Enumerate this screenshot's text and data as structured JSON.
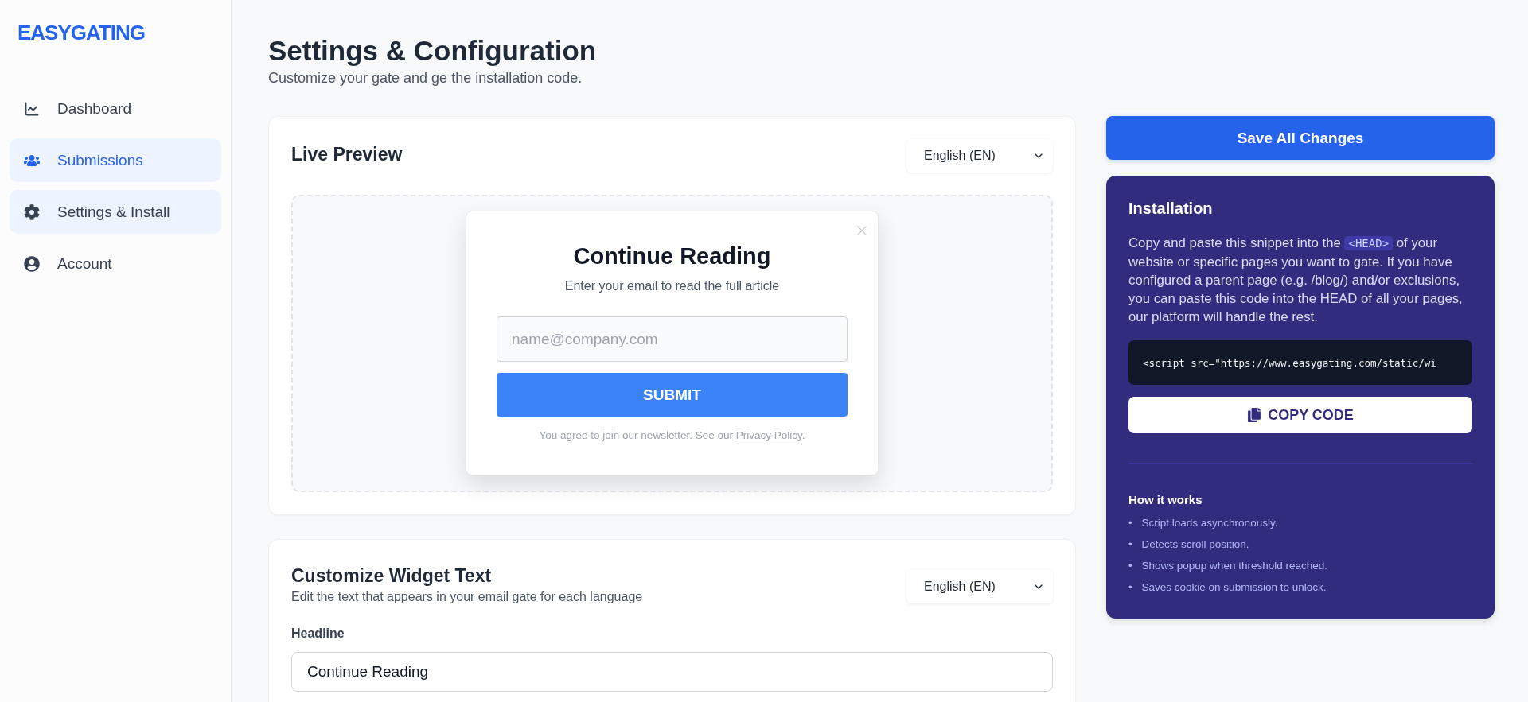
{
  "sidebar": {
    "logo": "EASYGATING",
    "items": [
      {
        "label": "Dashboard",
        "selected": false,
        "hovered": false
      },
      {
        "label": "Submissions",
        "selected": true,
        "hovered": false
      },
      {
        "label": "Settings & Install",
        "selected": false,
        "hovered": true
      },
      {
        "label": "Account",
        "selected": false,
        "hovered": false
      }
    ]
  },
  "header": {
    "title": "Settings & Configuration",
    "subtitle": "Customize your gate and ge the installation code."
  },
  "live_preview": {
    "title": "Live Preview",
    "language": "English (EN)",
    "popup": {
      "title": "Continue Reading",
      "subtitle": "Enter your email to read the full article",
      "placeholder": "name@company.com",
      "button": "SUBMIT",
      "footer": "You agree to join our newsletter. See our ",
      "footer_link": "Privacy Policy",
      "footer_end": "."
    }
  },
  "customize": {
    "title": "Customize Widget Text",
    "subtitle": "Edit the text that appears in your email gate for each language",
    "language": "English (EN)",
    "fields": [
      {
        "label": "Headline",
        "value": "Continue Reading"
      }
    ]
  },
  "save_button": "Save All Changes",
  "installation": {
    "title": "Installation",
    "text_before": "Copy and paste this snippet into the ",
    "code_tag": "<HEAD>",
    "text_after": " of your website or specific pages you want to gate. If you have configured a parent page (e.g. /blog/) and/or exclusions, you can paste this code into the HEAD of all your pages, our platform will handle the rest.",
    "snippet": "<script src=\"https://www.easygating.com/static/wi",
    "copy_button": "COPY CODE",
    "how_title": "How it works",
    "steps": [
      {
        "bullet": "•",
        "text": "Script loads asynchronously."
      },
      {
        "bullet": "•",
        "text": "Detects scroll position."
      },
      {
        "bullet": "•",
        "text": "Shows popup when threshold reached."
      },
      {
        "bullet": "•",
        "text": "Saves cookie on submission to unlock."
      }
    ]
  }
}
